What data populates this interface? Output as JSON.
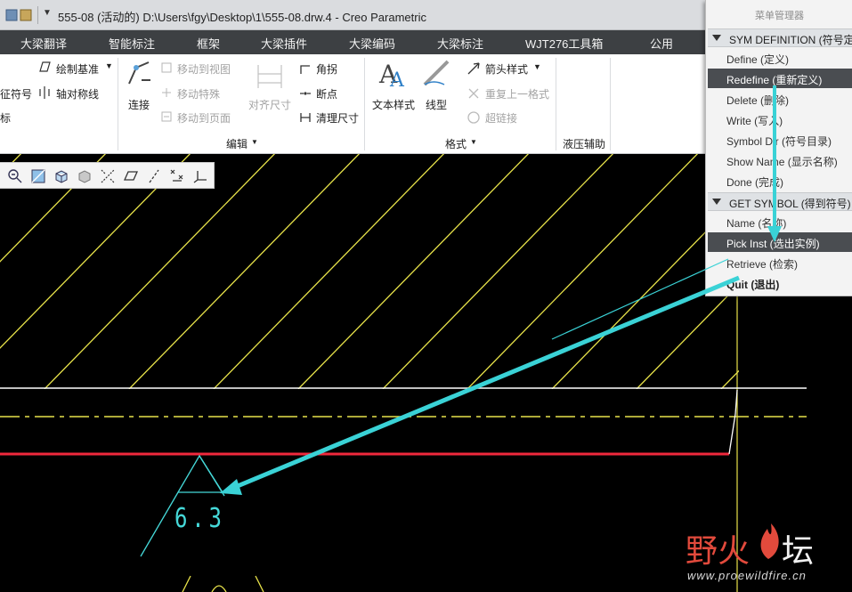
{
  "window": {
    "title": "555-08 (活动的) D:\\Users\\fgy\\Desktop\\1\\555-08.drw.4 - Creo Parametric"
  },
  "menubar": {
    "items": [
      "大梁翻译",
      "智能标注",
      "框架",
      "大梁插件",
      "大梁编码",
      "大梁标注",
      "WJT276工具箱",
      "公用"
    ]
  },
  "ribbon": {
    "left": {
      "draw_datum": "绘制基准",
      "symbol_trunc": "征符号",
      "axis_sym": "轴对称线",
      "mark_trunc": "标"
    },
    "edit": {
      "connect": "连接",
      "move_to_view": "移动到视图",
      "move_special": "移动特殊",
      "move_to_page": "移动到页面",
      "align_dim": "对齐尺寸",
      "corner": "角拐",
      "break_point": "断点",
      "clean_dim": "清理尺寸",
      "footer": "编辑"
    },
    "format": {
      "text_style": "文本样式",
      "line_type": "线型",
      "arrow_style": "箭头样式",
      "repeat_format": "重复上一格式",
      "hyperlink": "超链接",
      "footer": "格式"
    },
    "hydraulic": {
      "footer": "液压辅助"
    }
  },
  "graphics_toolbar": {
    "icons": [
      "zoom-in-icon",
      "refit-icon",
      "cube-view-icon",
      "shade-icon",
      "datum-display-icon",
      "plane-icon",
      "axis-icon",
      "point-icon",
      "csys-icon"
    ]
  },
  "menu_manager": {
    "title": "菜单管理器",
    "sections": [
      {
        "header": "SYM DEFINITION (符号定",
        "items": [
          {
            "label": "Define (定义)",
            "selected": false,
            "bold": false
          },
          {
            "label": "Redefine (重新定义)",
            "selected": true,
            "bold": false
          },
          {
            "label": "Delete (删除)",
            "selected": false,
            "bold": false
          },
          {
            "label": "Write (写入)",
            "selected": false,
            "bold": false
          },
          {
            "label": "Symbol Dir (符号目录)",
            "selected": false,
            "bold": false
          },
          {
            "label": "Show Name (显示名称)",
            "selected": false,
            "bold": false
          },
          {
            "label": "Done (完成)",
            "selected": false,
            "bold": false
          }
        ]
      },
      {
        "header": "GET SYMBOL (得到符号)",
        "items": [
          {
            "label": "Name (名称)",
            "selected": false,
            "bold": false
          },
          {
            "label": "Pick Inst (选出实例)",
            "selected": true,
            "bold": false
          },
          {
            "label": "Retrieve (检索)",
            "selected": false,
            "bold": false
          },
          {
            "label": "Quit (退出)",
            "selected": false,
            "bold": true
          }
        ]
      }
    ]
  },
  "drawing": {
    "roughness_value": "6.3"
  },
  "colors": {
    "hatch": "#e8e34a",
    "edge": "#ffffff",
    "red_line": "#f0283c",
    "cyan": "#45d8d8",
    "arrow": "#3ad2d6",
    "selected_bg": "#4a4d51"
  },
  "watermark": {
    "text_part1": "野火",
    "text_part2": "坛",
    "url": "www.proewildfire.cn"
  }
}
